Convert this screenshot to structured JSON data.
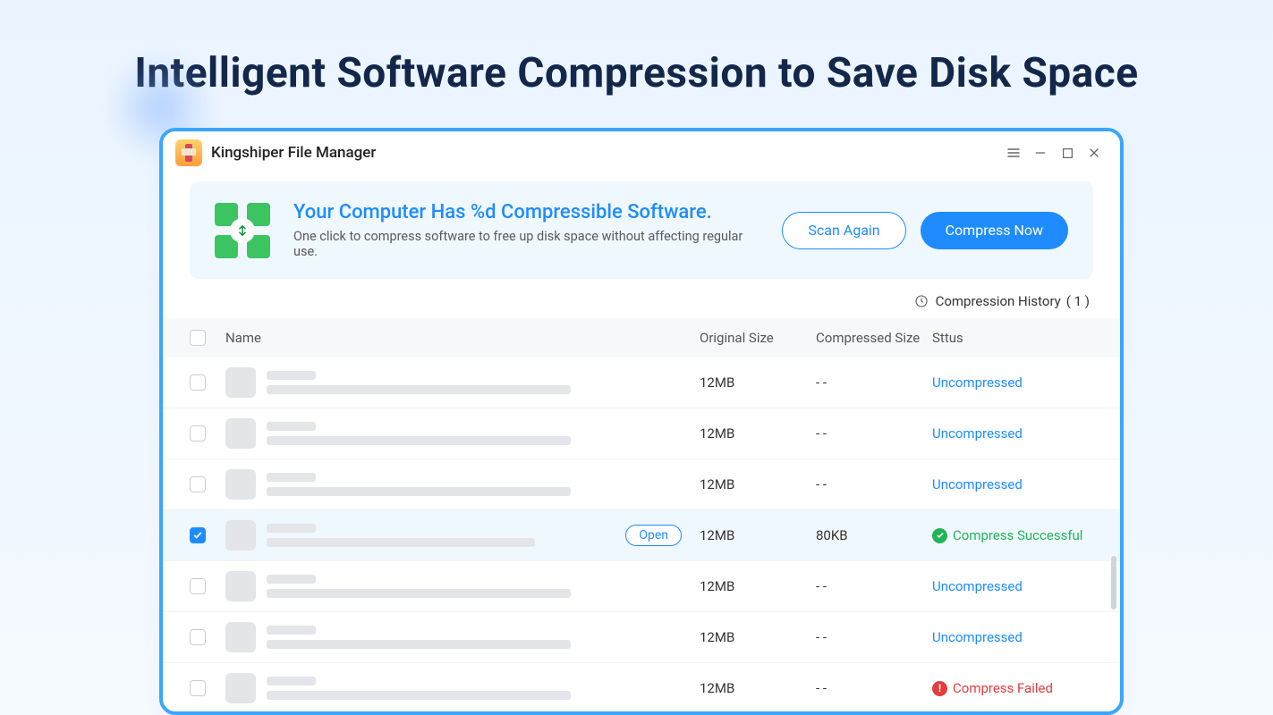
{
  "page": {
    "headline": "Intelligent Software Compression to Save Disk Space"
  },
  "app": {
    "title": "Kingshiper File Manager"
  },
  "banner": {
    "title": "Your Computer Has %d Compressible Software.",
    "subtitle": "One click to compress software to free up disk space without affecting regular use.",
    "scan_again": "Scan Again",
    "compress_now": "Compress Now"
  },
  "history": {
    "label": "Compression History",
    "count": "( 1 )"
  },
  "columns": {
    "name": "Name",
    "original_size": "Original Size",
    "compressed_size": "Compressed Size",
    "status": "Sttus"
  },
  "status_labels": {
    "uncompressed": "Uncompressed",
    "success": "Compress Successful",
    "failed": "Compress Failed"
  },
  "open_label": "Open",
  "rows": [
    {
      "checked": false,
      "original_size": "12MB",
      "compressed_size": "- -",
      "status": "uncompressed"
    },
    {
      "checked": false,
      "original_size": "12MB",
      "compressed_size": "- -",
      "status": "uncompressed"
    },
    {
      "checked": false,
      "original_size": "12MB",
      "compressed_size": "- -",
      "status": "uncompressed"
    },
    {
      "checked": true,
      "original_size": "12MB",
      "compressed_size": "80KB",
      "status": "success",
      "show_open": true
    },
    {
      "checked": false,
      "original_size": "12MB",
      "compressed_size": "- -",
      "status": "uncompressed"
    },
    {
      "checked": false,
      "original_size": "12MB",
      "compressed_size": "- -",
      "status": "uncompressed"
    },
    {
      "checked": false,
      "original_size": "12MB",
      "compressed_size": "- -",
      "status": "failed"
    }
  ]
}
